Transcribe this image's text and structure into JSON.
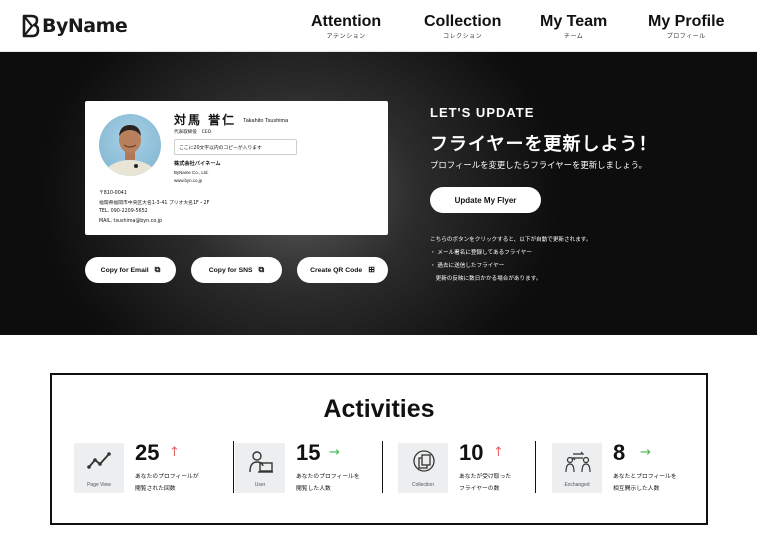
{
  "brand": {
    "logo_text": "ByName"
  },
  "nav": [
    {
      "label": "Attention",
      "sub": "アテンション"
    },
    {
      "label": "Collection",
      "sub": "コレクション"
    },
    {
      "label": "My Team",
      "sub": "チーム"
    },
    {
      "label": "My Profile",
      "sub": "プロフィール"
    }
  ],
  "card": {
    "name": "対馬 誉仁",
    "name_roman": "Takahito Tsushima",
    "role": "代表取締役　CEO",
    "copy_placeholder": "ここに20文字以内のコピーが入ります",
    "company": "株式会社バイネーム",
    "company_en": "ByName Co., Ltd.",
    "url": "www.byn.co.jp",
    "postal": "〒810-0041",
    "address": "福岡県福岡市中央区大名1-3-41 プリオ大名1F・2F",
    "tel": "TEL. 090-2209-5652",
    "mail": "MAIL. tsushima@byn.co.jp"
  },
  "actions": {
    "copy_email": "Copy for Email",
    "copy_sns": "Copy for SNS",
    "create_qr": "Create QR Code"
  },
  "hero": {
    "eyebrow": "LET'S UPDATE",
    "title": "フライヤーを更新しよう！",
    "subtitle": "プロフィールを変更したらフライヤーを更新しましょう。",
    "update_button": "Update My Flyer",
    "notes": [
      "こちらのボタンをクリックすると、以下が自動で更新されます。",
      "・ メール署名に登録してあるフライヤー",
      "・ 過去に送信したフライヤー",
      "　更新の反映に数日かかる場合があります。"
    ]
  },
  "activities": {
    "title": "Activities",
    "stats": [
      {
        "icon": "page-view-icon",
        "icon_label": "Page View",
        "value": "25",
        "trend": "up",
        "desc_1": "あなたのプロフィールが",
        "desc_2": "閲覧された回数"
      },
      {
        "icon": "user-icon",
        "icon_label": "User",
        "value": "15",
        "trend": "flat",
        "desc_1": "あなたのプロフィールを",
        "desc_2": "閲覧した人数"
      },
      {
        "icon": "collection-icon",
        "icon_label": "Collection",
        "value": "10",
        "trend": "up",
        "desc_1": "あなたが受け取った",
        "desc_2": "フライヤーの数"
      },
      {
        "icon": "exchanged-icon",
        "icon_label": "Exchanged",
        "value": "8",
        "trend": "flat",
        "desc_1": "あなたとプロフィールを",
        "desc_2": "相互開示した人数"
      }
    ],
    "colors": {
      "up": "#e06666",
      "flat": "#43b54a"
    }
  }
}
